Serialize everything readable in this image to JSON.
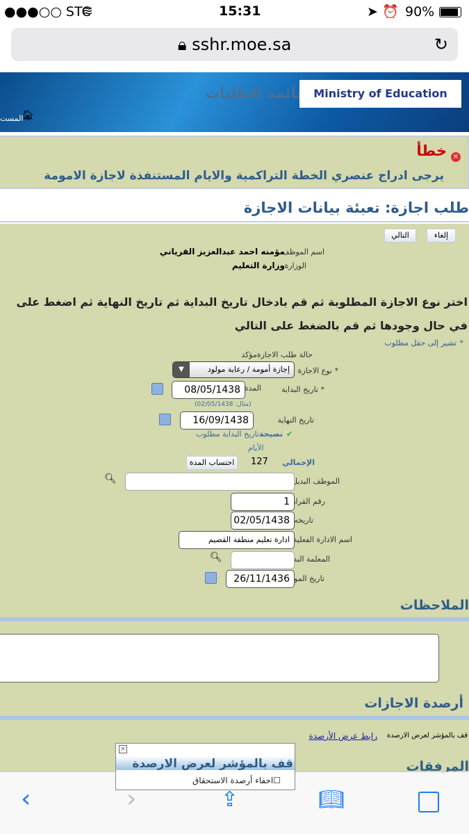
{
  "status_bar": {
    "carrier": "●●●○○ STC",
    "wifi": "wifi-icon",
    "time": "15:31",
    "battery": "90%"
  },
  "browser": {
    "url": "sshr.moe.sa"
  },
  "header": {
    "menu_title": "قائمة الطلبات",
    "logo_text": "Ministry of Education",
    "home_link": "المست"
  },
  "error": {
    "title": "خطأ",
    "message": "يرجى ادراج عنصري الخطة التراكمية والايام المستنفذة لاجازة الامومة"
  },
  "page_title": "طلب اجازة: تعبئة بيانات الاجازة",
  "buttons": {
    "cancel": "إلغاء",
    "next": "التالي",
    "calc": "احتساب المدة"
  },
  "employee": {
    "name_label": "اسم الموظف",
    "name": "مؤمنه احمد عبدالعزيز القرياني",
    "ministry_label": "الوزارة",
    "ministry": "وزارة التعليم"
  },
  "instructions": {
    "line1": "اختر نوع الاجازة المطلوبة ثم قم بادخال تاريخ البداية ثم تاريخ النهاية ثم اضغط على",
    "line2": "في حال وجودها ثم قم بالضغط على التالي"
  },
  "required_note": "تشير إلى حقل مطلوب",
  "form": {
    "status_label": "حالة طلب الاجازة",
    "status_value": "مؤكد",
    "type_label": "نوع الاجازة",
    "type_value": "إجازة أمومة / رعاية مولود",
    "duration_label": "المدة",
    "start_label": "تاريخ البداية",
    "start_value": "08/05/1438",
    "example": "(مثال: 02/05/1438)",
    "end_label": "تاريخ النهاية",
    "end_value": "16/09/1438",
    "tip_label": "نصيحة",
    "tip_text": "تاريخ البداية مطلوب",
    "days_label": "الأيام",
    "total_label": "الإجمالي",
    "total_value": "127",
    "substitute_label": "الموظف البديل",
    "substitute_value": "",
    "decision_no_label": "رقم القرار",
    "decision_no_value": "1",
    "decision_date_label": "تاريخه",
    "decision_date_value": "02/05/1438",
    "admin_label": "اسم الادارة الفعلية",
    "admin_value": "ادارة تعليم منطقة القصيم",
    "sub_teacher_label": "المعلمة البديلة",
    "sub_teacher_value": "",
    "birth_label": "تاريخ المولود",
    "birth_value": "26/11/1436"
  },
  "notes_title": "الملاحظات",
  "balances": {
    "title": "أرصدة الاجازات",
    "hint": "قف بالمؤشر لعرض الارصدة",
    "link": "رابط عرض الأرصدة"
  },
  "attachments_title": "المرفقات",
  "popup": {
    "heading": "قف بالمؤشر لعرض الارصدة",
    "checkbox_label": "اخفاء أرصدة الاستحقاق"
  }
}
